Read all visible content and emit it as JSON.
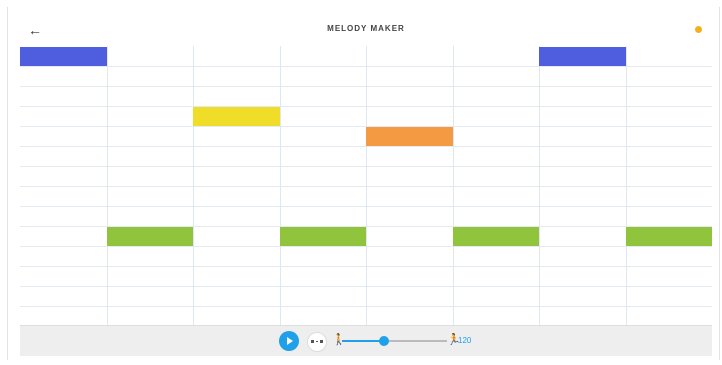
{
  "header": {
    "back_icon": "arrow-left-icon",
    "title": "MELODY MAKER",
    "help_icon": "help-dot-icon",
    "help_color": "#f3b01c"
  },
  "grid": {
    "columns": 8,
    "rows": 14,
    "notes": [
      {
        "color": "#4f5ddf",
        "col": 0,
        "row": 0
      },
      {
        "color": "#4f5ddf",
        "col": 6,
        "row": 0
      },
      {
        "color": "#efdd2a",
        "col": 2,
        "row": 3
      },
      {
        "color": "#f39a42",
        "col": 4,
        "row": 4
      },
      {
        "color": "#90c43c",
        "col": 1,
        "row": 9
      },
      {
        "color": "#90c43c",
        "col": 3,
        "row": 9
      },
      {
        "color": "#90c43c",
        "col": 5,
        "row": 9
      },
      {
        "color": "#90c43c",
        "col": 7,
        "row": 9
      }
    ]
  },
  "controls": {
    "play_icon": "play-icon",
    "loop_icon": "loop-icon",
    "slow_icon": "walking-person-icon",
    "fast_icon": "running-person-icon",
    "tempo_value": "120",
    "tempo_fraction": 0.4,
    "accent": "#1fa0e8"
  }
}
